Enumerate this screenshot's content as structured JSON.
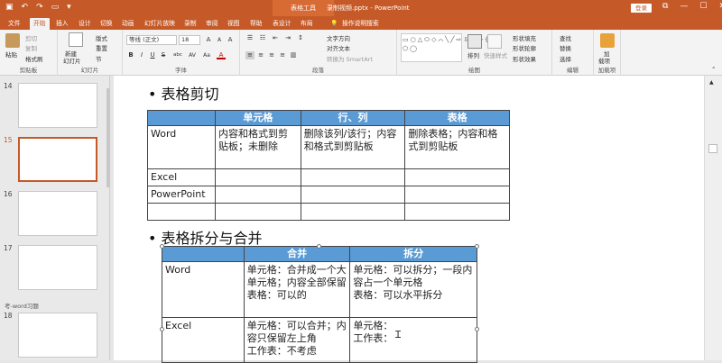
{
  "title_bar": {
    "contextual_tab": "表格工具",
    "document_title": "录制视频.pptx - PowerPoint",
    "login": "登录",
    "window_controls": [
      "⧉",
      "—",
      "☐",
      "✕"
    ]
  },
  "tabs": [
    "文件",
    "开始",
    "插入",
    "设计",
    "切换",
    "动画",
    "幻灯片放映",
    "录制",
    "审阅",
    "视图",
    "帮助",
    "表设计",
    "布局"
  ],
  "active_tab": "开始",
  "tell_me": "操作说明搜索",
  "ribbon": {
    "clipboard": {
      "label": "剪贴板",
      "paste": "粘贴",
      "cut": "剪切",
      "copy": "复制",
      "format_painter": "格式刷"
    },
    "slides": {
      "label": "幻灯片",
      "new_slide": "新建",
      "new_slide_2": "幻灯片",
      "layout": "版式",
      "reset": "重置",
      "section": "节"
    },
    "font": {
      "label": "字体",
      "font_name": "等线 (正文)",
      "font_size": "18",
      "bold": "B",
      "italic": "I",
      "underline": "U",
      "strike": "S",
      "abc": "abc",
      "av": "AV",
      "aa": "Aa",
      "grow": "A",
      "shrink": "A",
      "clear": "A",
      "color": "A"
    },
    "paragraph": {
      "label": "段落",
      "text_direction": "文字方向",
      "align_text": "对齐文本",
      "smartart": "转换为 SmartArt"
    },
    "drawing": {
      "label": "绘图",
      "arrange": "排列",
      "quick_styles": "快速样式",
      "fill": "形状填充",
      "outline": "形状轮廓",
      "effects": "形状效果"
    },
    "editing": {
      "label": "编辑",
      "find": "查找",
      "replace": "替换",
      "select": "选择"
    },
    "addin": {
      "label": "加载项",
      "btn": "加",
      "btn2": "载项"
    }
  },
  "slides": [
    {
      "num": "14"
    },
    {
      "num": "15"
    },
    {
      "num": "16"
    },
    {
      "num": "17"
    },
    {
      "num": "18"
    }
  ],
  "section_title": "考-word习题",
  "slide": {
    "heading1": "• 表格剪切",
    "table1": {
      "headers": [
        "",
        "单元格",
        "行、列",
        "表格"
      ],
      "rows": [
        [
          "Word",
          "内容和格式到剪贴板；未删除",
          "删除该列/该行；内容和格式到剪贴板",
          "删除表格；内容和格式到剪贴板"
        ],
        [
          "Excel",
          "",
          "",
          ""
        ],
        [
          "PowerPoint",
          "",
          "",
          ""
        ],
        [
          "",
          "",
          "",
          ""
        ]
      ]
    },
    "heading2": "• 表格拆分与合并",
    "table2": {
      "headers": [
        "",
        "合并",
        "拆分"
      ],
      "rows": [
        [
          "Word",
          "单元格：合并成一个大单元格；内容全部保留\n表格：可以的",
          "单元格：可以拆分；一段内容占一个单元格\n表格：可以水平拆分"
        ],
        [
          "Excel",
          "单元格：可以合并；内容只保留左上角\n工作表：不考虑",
          "单元格：\n工作表："
        ]
      ]
    }
  }
}
